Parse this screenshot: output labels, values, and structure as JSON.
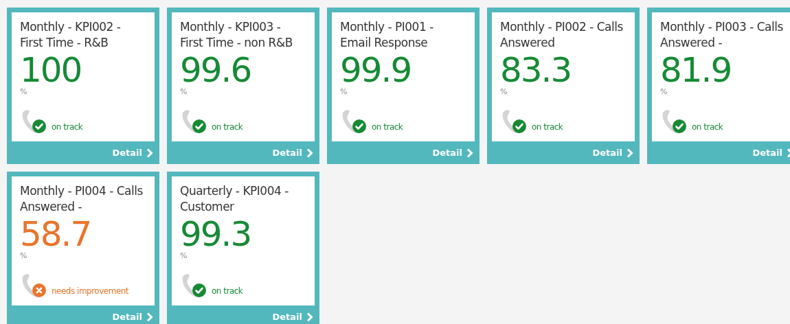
{
  "cards": [
    {
      "title": "Monthly - KPI002 - First Time - R&B",
      "value": "100",
      "unit": "%",
      "status": {
        "kind": "ok",
        "label": "on track"
      },
      "link": "Detail"
    },
    {
      "title": "Monthly - KPI003 - First Time - non R&B",
      "value": "99.6",
      "unit": "%",
      "status": {
        "kind": "ok",
        "label": "on track"
      },
      "link": "Detail"
    },
    {
      "title": "Monthly - PI001 - Email Response",
      "value": "99.9",
      "unit": "%",
      "status": {
        "kind": "ok",
        "label": "on track"
      },
      "link": "Detail"
    },
    {
      "title": "Monthly - PI002 - Calls Answered",
      "value": "83.3",
      "unit": "%",
      "status": {
        "kind": "ok",
        "label": "on track"
      },
      "link": "Detail"
    },
    {
      "title": "Monthly - PI003 - Calls Answered -",
      "value": "81.9",
      "unit": "%",
      "status": {
        "kind": "ok",
        "label": "on track"
      },
      "link": "Detail"
    },
    {
      "title": "Monthly - PI004 - Calls Answered -",
      "value": "58.7",
      "unit": "%",
      "status": {
        "kind": "warn",
        "label": "needs improvement"
      },
      "link": "Detail"
    },
    {
      "title": "Quarterly - KPI004 - Customer",
      "value": "99.3",
      "unit": "%",
      "status": {
        "kind": "ok",
        "label": "on track"
      },
      "link": "Detail"
    }
  ]
}
